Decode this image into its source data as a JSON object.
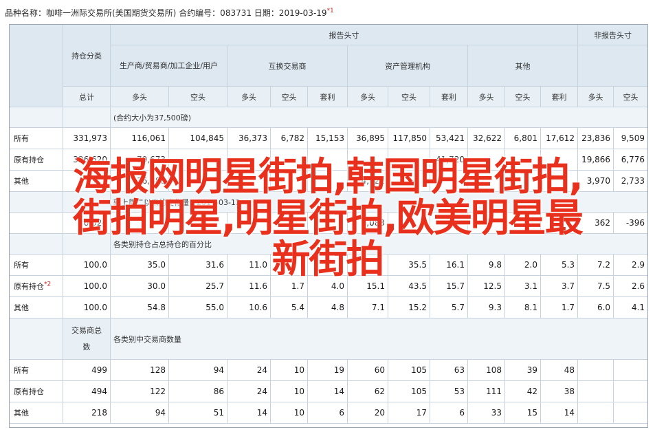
{
  "caption": {
    "text": "品种名称：咖啡一洲际交易所(美国期货交易所)   合约编号：083731   日期：2019-03-19",
    "footnote": "*1"
  },
  "header": {
    "report_header": "报告头寸",
    "non_report_header": "非报告头寸",
    "position_category": "持仓分类",
    "group_producers": "生产商/贸易商/加工企业/用户",
    "group_swap": "互换交易商",
    "group_asset": "资产管理机构",
    "group_other": "其他",
    "total": "总计",
    "long": "多头",
    "short": "空头",
    "spread": "套利"
  },
  "section1": {
    "title": "(合约大小为37,500磅)"
  },
  "rows1": [
    {
      "label": "所有",
      "values": [
        "331,973",
        "116,061",
        "104,845",
        "36,373",
        "6,782",
        "15,153",
        "36,895",
        "117,850",
        "53,421",
        "32,622",
        "6,801",
        "17,612",
        "23,836",
        "9,509"
      ]
    },
    {
      "label": "原有持仓",
      "values": [
        "326,620",
        "79,673",
        "",
        "",
        "",
        "",
        "",
        "",
        "41,720",
        "",
        "",
        "",
        "19,866",
        "6,776"
      ]
    },
    {
      "label": "其他",
      "values": [
        "",
        "36,388",
        "",
        "",
        "",
        "",
        "14,721",
        "",
        "",
        "",
        "",
        "",
        "3,970",
        "2,733"
      ]
    }
  ],
  "section2": {
    "title": "较上周二以来的变化量：2019-03-12"
  },
  "rows2": [
    {
      "label": "",
      "values": [
        "6,024",
        "",
        "",
        "",
        "",
        "",
        "9,083",
        "",
        "",
        "",
        "",
        "",
        "362",
        "-396"
      ]
    }
  ],
  "section3": {
    "title": "各类别持仓占总持仓的百分比"
  },
  "rows3": [
    {
      "label": "所有",
      "values": [
        "100.0",
        "35.0",
        "31.6",
        "11.0",
        "",
        "",
        "",
        "35.5",
        "16.1",
        "9.8",
        "2.0",
        "5.3",
        "7.2",
        "2.9"
      ]
    },
    {
      "label": "原有持仓",
      "footnote": "*2",
      "values": [
        "100.0",
        "30.0",
        "25.7",
        "11.6",
        "1.7",
        "4.0",
        "15.1",
        "43.5",
        "15.7",
        "12.5",
        "3.1",
        "3.7",
        "7.5",
        "2.6"
      ]
    },
    {
      "label": "其他",
      "values": [
        "100.0",
        "54.8",
        "55.0",
        "10.6",
        "5.4",
        "4.8",
        "7.1",
        "15.2",
        "5.7",
        "9.3",
        "8.1",
        "1.7",
        "6.0",
        "4.1"
      ]
    }
  ],
  "section4": {
    "left_line1": "交易商总",
    "left_line2": "数",
    "title": "各类别中交易商数量"
  },
  "rows4": [
    {
      "label": "所有",
      "values": [
        "499",
        "128",
        "94",
        "24",
        "10",
        "19",
        "60",
        "105",
        "63",
        "108",
        "39",
        "48",
        "",
        ""
      ]
    },
    {
      "label": "原有持仓",
      "values": [
        "494",
        "122",
        "86",
        "24",
        "10",
        "14",
        "62",
        "105",
        "53",
        "111",
        "42",
        "38",
        "",
        ""
      ]
    },
    {
      "label": "其他",
      "values": [
        "218",
        "94",
        "51",
        "14",
        "10",
        "6",
        "20",
        "17",
        "6",
        "33",
        "15",
        "14",
        "",
        ""
      ]
    }
  ],
  "overlay": {
    "line1": "海报网明星街拍,韩国明星街拍,",
    "line2": "街拍明星,明星街拍,欧美明星最",
    "line3": "新街拍"
  }
}
